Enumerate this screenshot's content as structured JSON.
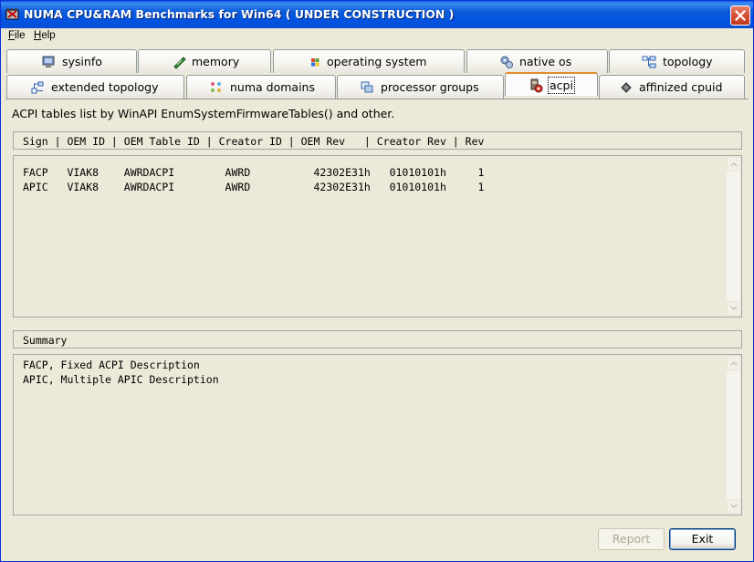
{
  "window": {
    "title": "NUMA CPU&RAM Benchmarks for Win64 ( UNDER CONSTRUCTION )"
  },
  "menu": [
    {
      "label": "File",
      "mnemonic": "F",
      "rest": "ile"
    },
    {
      "label": "Help",
      "mnemonic": "H",
      "rest": "elp"
    }
  ],
  "tabs_row1": [
    {
      "label": "sysinfo",
      "icon": "monitor-icon"
    },
    {
      "label": "memory",
      "icon": "memory-stick-icon"
    },
    {
      "label": "operating system",
      "icon": "windows-logo-icon"
    },
    {
      "label": "native os",
      "icon": "gears-icon"
    },
    {
      "label": "topology",
      "icon": "topology-icon"
    }
  ],
  "tabs_row2": [
    {
      "label": "extended topology",
      "icon": "tree-icon"
    },
    {
      "label": "numa domains",
      "icon": "dots-grid-icon"
    },
    {
      "label": "processor groups",
      "icon": "windows-stack-icon"
    },
    {
      "label": "acpi",
      "icon": "acpi-icon",
      "active": true
    },
    {
      "label": "affinized cpuid",
      "icon": "chip-icon"
    }
  ],
  "acpi": {
    "description": "ACPI tables list by WinAPI EnumSystemFirmwareTables() and other.",
    "table_header": "Sign | OEM ID | OEM Table ID | Creator ID | OEM Rev   | Creator Rev | Rev",
    "table_rows": "FACP   VIAK8    AWRDACPI        AWRD          42302E31h   01010101h     1\nAPIC   VIAK8    AWRDACPI        AWRD          42302E31h   01010101h     1",
    "summary_header": "Summary",
    "summary_text": "FACP, Fixed ACPI Description\nAPIC, Multiple APIC Description"
  },
  "buttons": {
    "report": "Report",
    "exit": "Exit"
  },
  "colors": {
    "titlebar": "#0054e3",
    "active_tab_accent": "#e68b2c",
    "close_button": "#d8533a"
  }
}
